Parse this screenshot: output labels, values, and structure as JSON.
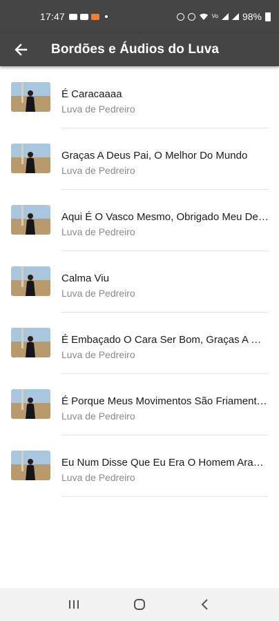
{
  "status_bar": {
    "time": "17:47",
    "battery": "98%",
    "icons": [
      "message-icon",
      "message-icon",
      "app-icon",
      "notification-dot",
      "alarm-icon",
      "mute-icon",
      "wifi-icon",
      "volte-icon",
      "signal-icon",
      "signal-icon",
      "battery-icon"
    ]
  },
  "app_bar": {
    "title": "Bordões e Áudios do Luva",
    "back_icon": "arrow-left-icon"
  },
  "items": [
    {
      "title": "É Caracaaaa",
      "subtitle": "Luva de Pedreiro"
    },
    {
      "title": "Graças A Deus Pai, O Melhor Do Mundo",
      "subtitle": "Luva de Pedreiro"
    },
    {
      "title": "Aqui É O Vasco Mesmo, Obrigado Meu Deus",
      "subtitle": "Luva de Pedreiro"
    },
    {
      "title": "Calma Viu",
      "subtitle": "Luva de Pedreiro"
    },
    {
      "title": "É Embaçado O Cara Ser Bom, Graças A Deus",
      "subtitle": "Luva de Pedreiro"
    },
    {
      "title": "É Porque Meus Movimentos São Friamente Calculados",
      "subtitle": "Luva de Pedreiro"
    },
    {
      "title": "Eu Num Disse Que Eu Era O Homem Aranha",
      "subtitle": "Luva de Pedreiro"
    }
  ],
  "nav_bar": {
    "icons": [
      "recent-apps-icon",
      "home-icon",
      "back-icon"
    ]
  },
  "colors": {
    "app_bar": "#454545",
    "title_text": "#1a1a1a",
    "subtitle_text": "#8a8a8a",
    "divider": "#e3e3e3",
    "nav_bar": "#f2f2f2"
  }
}
